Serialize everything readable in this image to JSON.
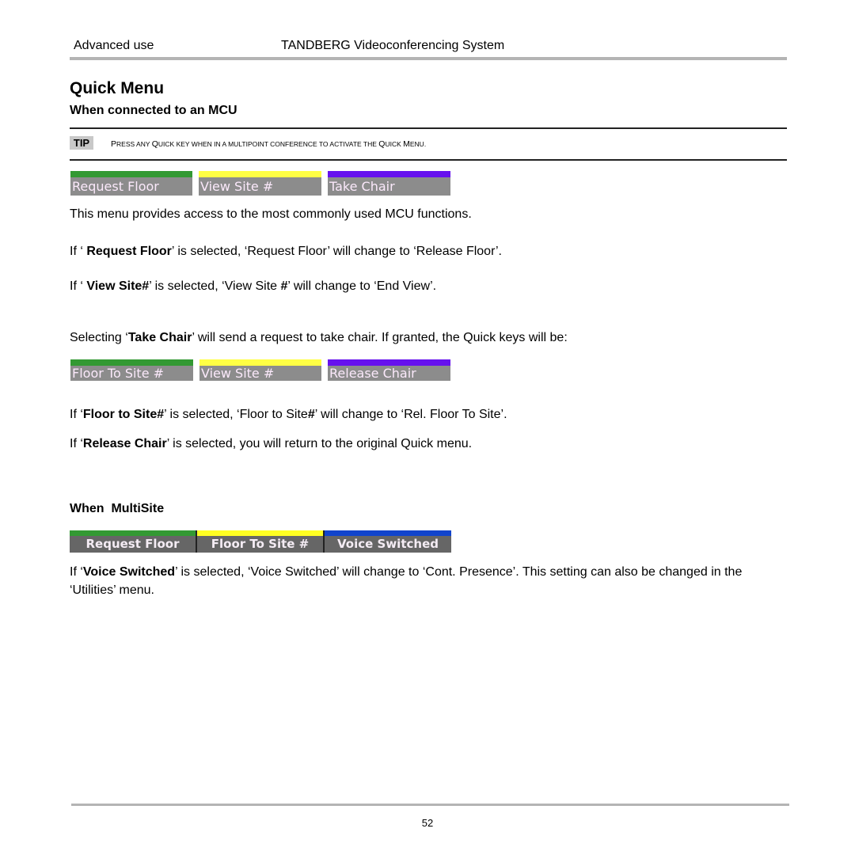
{
  "header": {
    "section": "Advanced use",
    "product": "TANDBERG Videoconferencing System"
  },
  "title": "Quick Menu",
  "subtitle": "When connected to an MCU",
  "tip": {
    "badge": "TIP",
    "text_parts": [
      "P",
      "RESS ANY ",
      "Q",
      "UICK KEY WHEN IN A MULTIPOINT CONFERENCE TO ACTIVATE THE ",
      "Q",
      "UICK ",
      "M",
      "ENU."
    ]
  },
  "quick_menu_mcu": [
    {
      "label": "Request Floor",
      "color": "#339933"
    },
    {
      "label": "View Site #",
      "color": "#ffff44"
    },
    {
      "label": "Take Chair",
      "color": "#6611ee"
    }
  ],
  "paragraphs_mcu": {
    "p1": "This menu provides access to the most commonly used MCU functions.",
    "p2": {
      "a": "If ‘ ",
      "b": "Request Floor",
      "c": "’ is selected, ‘Request Floor’ will change to ‘Release Floor’."
    },
    "p3": {
      "a": "If ‘ ",
      "b": "View Site#",
      "c": "’ is selected, ‘View Site ",
      "d": "#",
      "e": "’ will change to ‘End View’."
    },
    "p4": {
      "a": "Selecting ‘",
      "b": "Take Chair",
      "c": "’ will send a request to take chair. If granted, the Quick keys will be:"
    }
  },
  "quick_menu_chair": [
    {
      "label": "Floor To Site #",
      "color": "#339933"
    },
    {
      "label": "View Site #",
      "color": "#ffff44"
    },
    {
      "label": "Release Chair",
      "color": "#6611ee"
    }
  ],
  "paragraphs_chair": {
    "p1": {
      "a": "If ‘",
      "b": "Floor to Site#",
      "c": "’ is selected, ‘Floor to Site",
      "d": "#",
      "e": "’ will change to ‘Rel. Floor To Site’."
    },
    "p2": {
      "a": "If ‘",
      "b": "Release Chair",
      "c": "’ is selected, you will return to the original Quick menu."
    }
  },
  "multisite_heading": "When  MultiSite",
  "quick_menu_multisite": [
    {
      "label": "Request Floor",
      "color": "#339933"
    },
    {
      "label": "Floor To Site #",
      "color": "#ffff22"
    },
    {
      "label": "Voice Switched",
      "color": "#1144cc"
    }
  ],
  "paragraphs_multisite": {
    "p1": {
      "a": "If ‘",
      "b": "Voice Switched",
      "c": "’ is selected, ‘Voice Switched’ will change to ‘Cont. Presence’. This setting can also be changed in the ‘Utilities’ menu."
    }
  },
  "footer": {
    "page_number": "52"
  }
}
